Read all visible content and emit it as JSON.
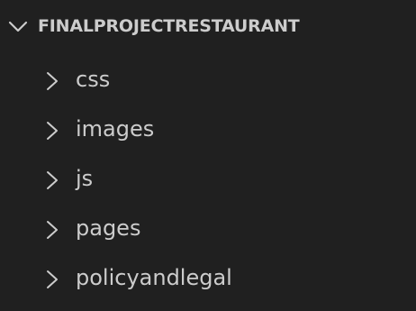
{
  "explorer": {
    "root": {
      "label": "FINALPROJECTRESTAURANT",
      "expanded": true,
      "icon": "chevron-down-icon"
    },
    "folders": [
      {
        "label": "css",
        "icon": "chevron-right-icon",
        "expanded": false
      },
      {
        "label": "images",
        "icon": "chevron-right-icon",
        "expanded": false
      },
      {
        "label": "js",
        "icon": "chevron-right-icon",
        "expanded": false
      },
      {
        "label": "pages",
        "icon": "chevron-right-icon",
        "expanded": false
      },
      {
        "label": "policyandlegal",
        "icon": "chevron-right-icon",
        "expanded": false
      }
    ]
  },
  "colors": {
    "background": "#202020",
    "text": "#cccccc"
  }
}
